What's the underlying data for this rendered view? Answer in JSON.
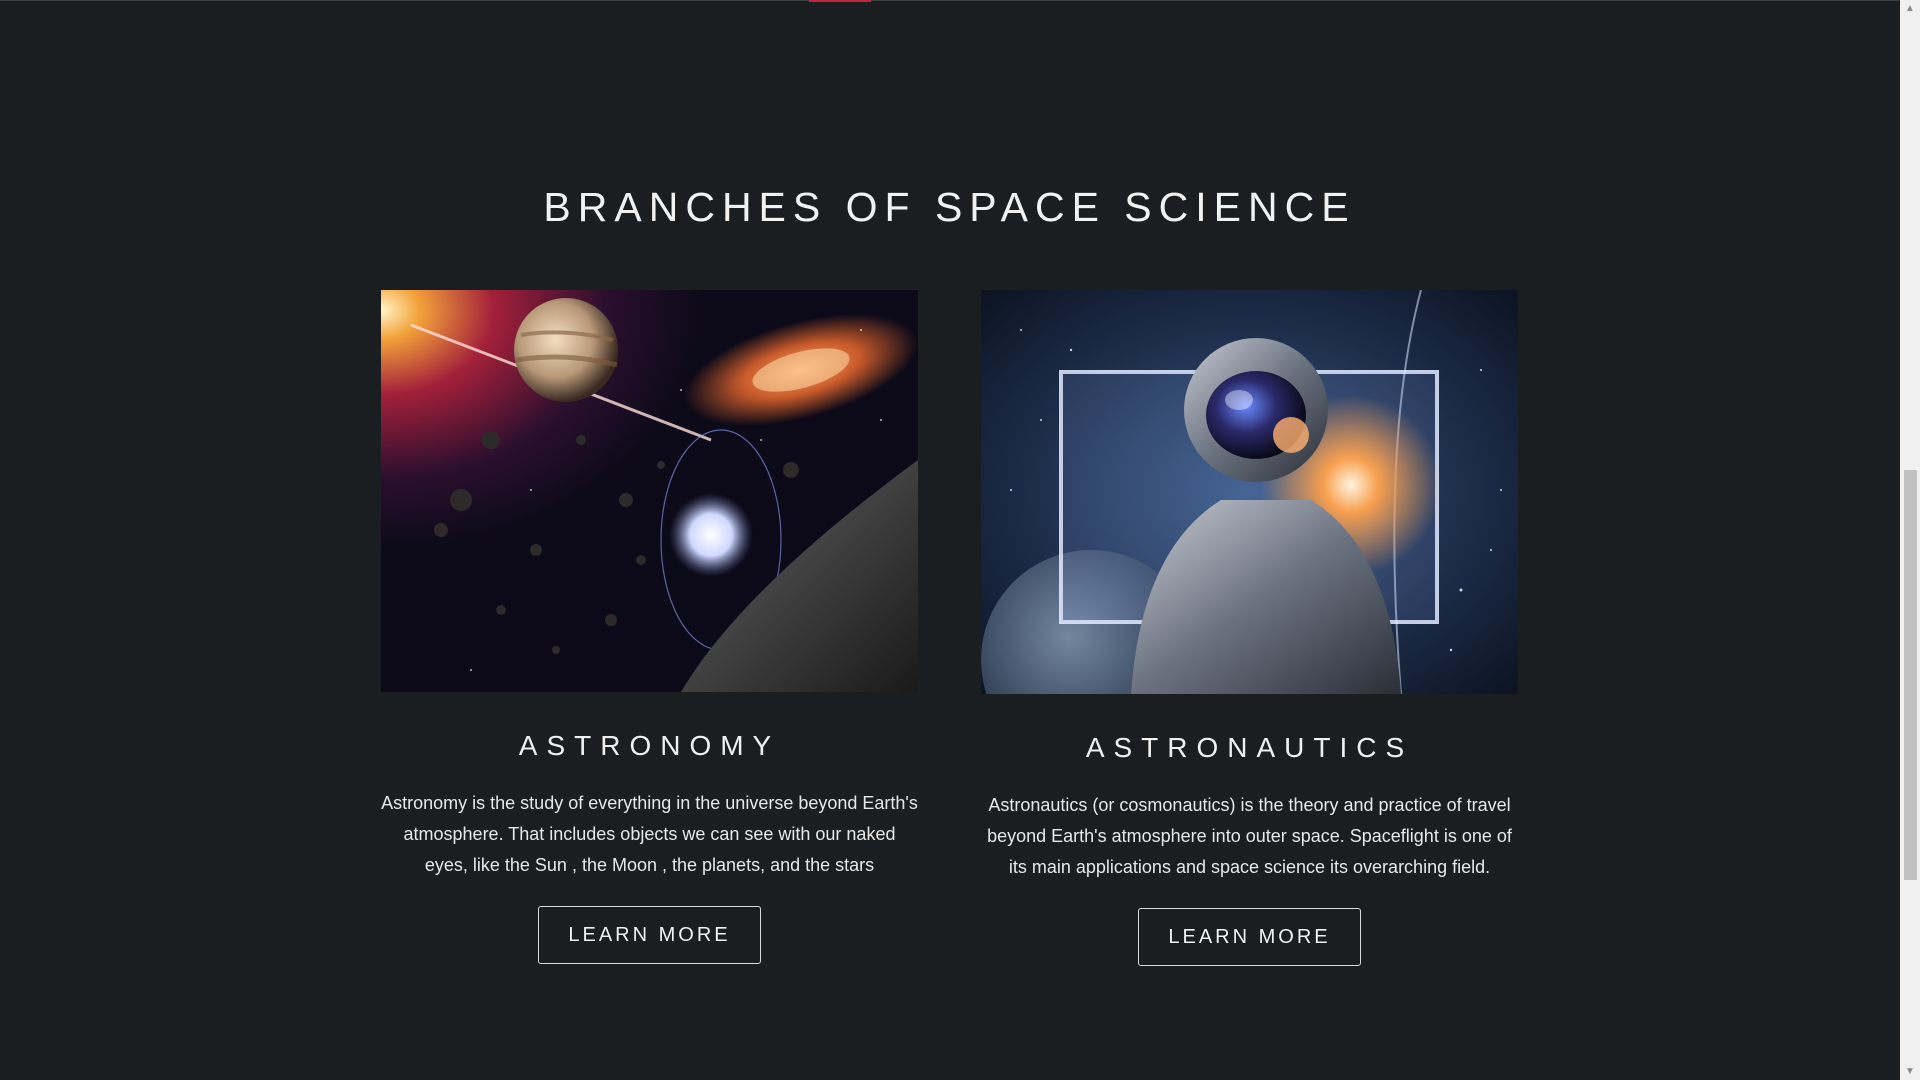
{
  "section": {
    "title": "BRANCHES OF SPACE SCIENCE"
  },
  "cards": [
    {
      "heading": "ASTRONOMY",
      "text": "Astronomy is the study of everything in the universe beyond Earth's atmosphere. That includes objects we can see with our naked eyes, like the Sun , the Moon , the planets, and the stars",
      "button_label": "LEARN MORE"
    },
    {
      "heading": "ASTRONAUTICS",
      "text": "Astronautics (or cosmonautics) is the theory and practice of travel beyond Earth's atmosphere into outer space. Spaceflight is one of its main applications and space science its overarching field.",
      "button_label": "LEARN MORE"
    }
  ],
  "scrollbar": {
    "up_icon": "▲",
    "down_icon": "▼"
  },
  "colors": {
    "background": "#1a1e21",
    "accent": "#c0263a"
  }
}
